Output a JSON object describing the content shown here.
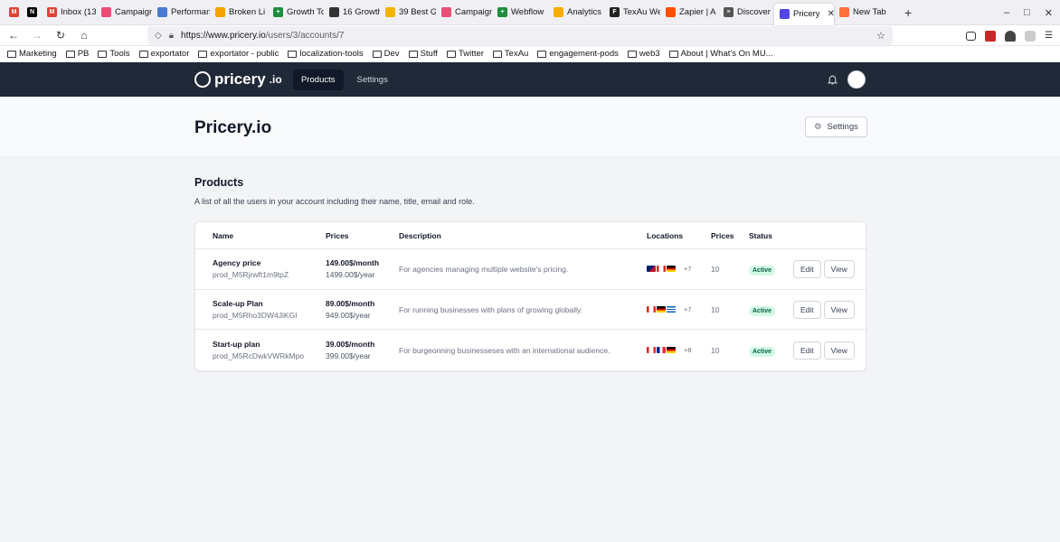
{
  "browser": {
    "tabs": [
      {
        "label": "",
        "fav_color": "#db4437",
        "fav_char": "M"
      },
      {
        "label": "",
        "fav_color": "#000000",
        "fav_char": "N"
      },
      {
        "label": "Inbox (13",
        "fav_color": "#db4437",
        "fav_char": "M"
      },
      {
        "label": "Campaign",
        "fav_color": "#e94e77",
        "fav_char": ""
      },
      {
        "label": "Performan",
        "fav_color": "#4a7bd0",
        "fav_char": ""
      },
      {
        "label": "Broken Li",
        "fav_color": "#f4a300",
        "fav_char": ""
      },
      {
        "label": "Growth To",
        "fav_color": "#1e8e3e",
        "fav_char": "+"
      },
      {
        "label": "16 Growth",
        "fav_color": "#333333",
        "fav_char": ""
      },
      {
        "label": "39 Best G",
        "fav_color": "#f2b400",
        "fav_char": ""
      },
      {
        "label": "Campaign",
        "fav_color": "#e94e77",
        "fav_char": ""
      },
      {
        "label": "Webflow",
        "fav_color": "#1e8e3e",
        "fav_char": "+"
      },
      {
        "label": "Analytics",
        "fav_color": "#f9ab00",
        "fav_char": ""
      },
      {
        "label": "TexAu We",
        "fav_color": "#222222",
        "fav_char": "F"
      },
      {
        "label": "Zapier | A",
        "fav_color": "#ff4f00",
        "fav_char": ""
      },
      {
        "label": "Discover",
        "fav_color": "#555555",
        "fav_char": "≡"
      },
      {
        "label": "Pricery",
        "fav_color": "#4f46e5",
        "fav_char": "",
        "active": true
      },
      {
        "label": "New Tab",
        "fav_color": "#ff7139",
        "fav_char": ""
      }
    ],
    "url_host": "https://www.pricery.io",
    "url_path": "/users/3/accounts/7",
    "bookmarks": [
      "Marketing",
      "PB",
      "Tools",
      "exportator",
      "exportator - public",
      "localization-tools",
      "Dev",
      "Stuff",
      "Twitter",
      "TexAu",
      "engagement-pods",
      "web3",
      "About | What's On MU..."
    ]
  },
  "app": {
    "logo": "pricery",
    "logo_suffix": ".io",
    "nav": [
      {
        "label": "Products",
        "active": true
      },
      {
        "label": "Settings",
        "active": false
      }
    ],
    "page_title": "Pricery.io",
    "settings_button": "Settings",
    "section_title": "Products",
    "section_desc": "A list of all the users in your account including their name, title, email and role.",
    "columns": {
      "name": "Name",
      "prices": "Prices",
      "description": "Description",
      "locations": "Locations",
      "prices_count": "Prices",
      "status": "Status"
    },
    "products": [
      {
        "name": "Agency price",
        "id": "prod_M5Rjrwft1m9tpZ",
        "price_month": "149.00$/month",
        "price_year": "1499.00$/year",
        "description": "For agencies managing multiple website's pricing.",
        "flags": [
          "au",
          "ca",
          "de"
        ],
        "more": "+7",
        "prices": "10",
        "status": "Active",
        "edit": "Edit",
        "view": "View"
      },
      {
        "name": "Scale-up Plan",
        "id": "prod_M5Rho3DW4JiKGI",
        "price_month": "89.00$/month",
        "price_year": "949.00$/year",
        "description": "For running businesses with plans of growing globally.",
        "flags": [
          "ca",
          "de",
          "gr"
        ],
        "more": "+7",
        "prices": "10",
        "status": "Active",
        "edit": "Edit",
        "view": "View"
      },
      {
        "name": "Start-up plan",
        "id": "prod_M5RcDwkVWRkMpo",
        "price_month": "39.00$/month",
        "price_year": "399.00$/year",
        "description": "For burgeonning businesseses with an international audience.",
        "flags": [
          "ca",
          "fr",
          "de"
        ],
        "more": "+8",
        "prices": "10",
        "status": "Active",
        "edit": "Edit",
        "view": "View"
      }
    ]
  }
}
